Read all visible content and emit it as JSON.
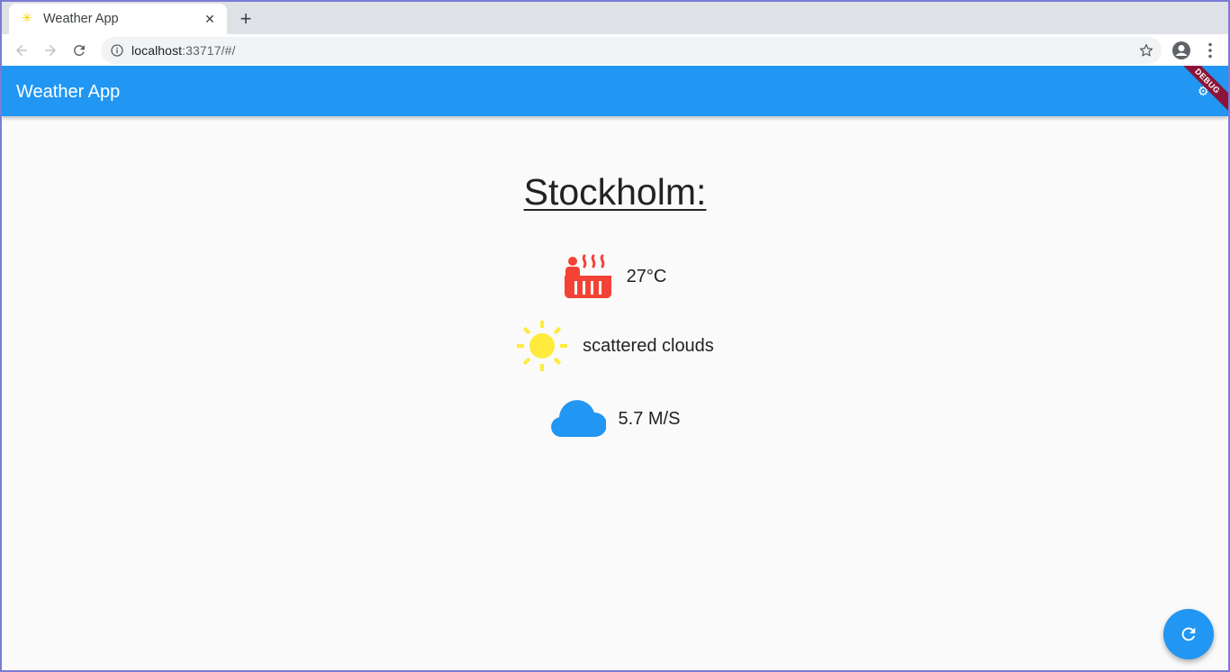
{
  "browser": {
    "tab": {
      "title": "Weather App",
      "favicon": "sun-favicon-icon"
    },
    "url": {
      "host": "localhost",
      "path": ":33717/#/"
    }
  },
  "app": {
    "title": "Weather App",
    "debug_label": "DEBUG",
    "city": "Stockholm:",
    "temperature": "27°C",
    "description": "scattered clouds",
    "wind": "5.7 M/S",
    "colors": {
      "appbar": "#2196f3",
      "temperature_icon": "#f44336",
      "sun_icon": "#ffeb3b",
      "cloud_icon": "#2196f3"
    },
    "icons": {
      "temperature": "hot-tub-icon",
      "description": "sun-icon",
      "wind": "cloud-icon",
      "fab": "refresh-icon"
    }
  }
}
